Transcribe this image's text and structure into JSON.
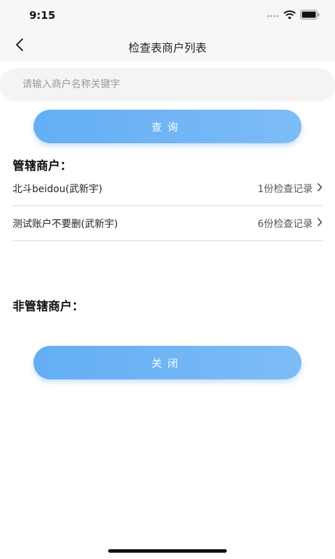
{
  "status_bar": {
    "time": "9:15"
  },
  "nav": {
    "title": "检查表商户列表"
  },
  "search": {
    "placeholder": "请输入商户名称关键字",
    "value": ""
  },
  "buttons": {
    "query": "查询",
    "close": "关闭"
  },
  "sections": {
    "managed": "管辖商户：",
    "unmanaged": "非管辖商户："
  },
  "merchants": [
    {
      "name": "北斗beidou(武新宇)",
      "records": "1份检查记录"
    },
    {
      "name": "测试账户不要删(武新宇)",
      "records": "6份检查记录"
    }
  ]
}
